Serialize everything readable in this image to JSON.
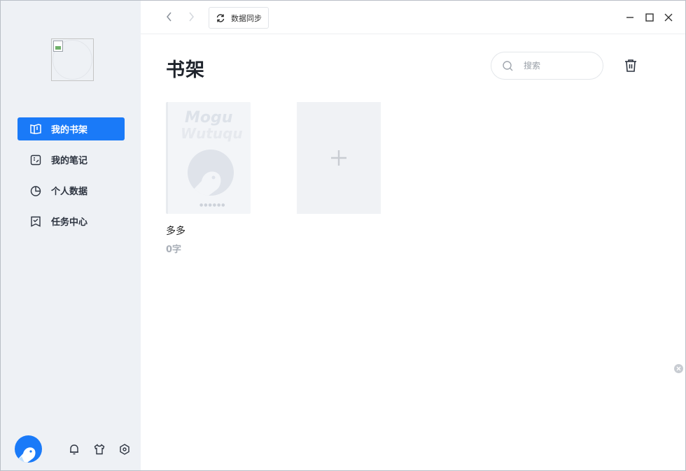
{
  "sidebar": {
    "items": [
      {
        "label": "我的书架",
        "icon": "bookshelf-icon",
        "active": true
      },
      {
        "label": "我的笔记",
        "icon": "notes-icon",
        "active": false
      },
      {
        "label": "个人数据",
        "icon": "pie-chart-icon",
        "active": false
      },
      {
        "label": "任务中心",
        "icon": "task-icon",
        "active": false
      }
    ],
    "bottom_icons": [
      "bell-icon",
      "tshirt-icon",
      "settings-icon"
    ]
  },
  "topbar": {
    "sync_label": "数据同步"
  },
  "main": {
    "title": "书架",
    "search": {
      "placeholder": "搜索"
    },
    "books": [
      {
        "title": "多多",
        "words": "0字",
        "cover_text_1": "Mogu",
        "cover_text_2": "Wutuqu",
        "cover_dots": "●●●●●●"
      }
    ]
  },
  "colors": {
    "accent": "#1a7af8",
    "sidebar_bg": "#eef1f5"
  }
}
